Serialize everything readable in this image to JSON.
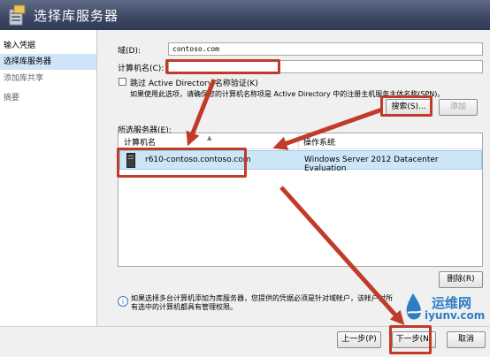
{
  "window": {
    "title": "选择库服务器"
  },
  "nav": {
    "items": [
      {
        "label": "输入凭据",
        "selected": false
      },
      {
        "label": "选择库服务器",
        "selected": true
      },
      {
        "label": "添加库共享",
        "selected": false
      },
      {
        "label": "摘要",
        "selected": false
      }
    ]
  },
  "form": {
    "domain_label": "域(D):",
    "domain_value": "contoso.com",
    "computer_label": "计算机名(C):",
    "computer_value": "",
    "skip_ad_label": "跳过 Active Directory 名称验证(K)",
    "skip_ad_note": "如果使用此选项，请确保您的计算机名称项是 Active Directory 中的注册主机服务主体名称(SPN)。",
    "search_button": "搜索(S)...",
    "add_button": "添加",
    "selected_servers_label": "所选服务器(E):",
    "remove_button": "删除(R)"
  },
  "table": {
    "columns": [
      "计算机名",
      "操作系统"
    ],
    "rows": [
      {
        "name": "r610-contoso.contoso.com",
        "os": "Windows Server 2012 Datacenter Evaluation"
      }
    ]
  },
  "info": {
    "text": "如果选择多台计算机添加为库服务器，您提供的凭据必须是针对域帐户，该帐户对所有选中的计算机都具有管理权限。"
  },
  "footer": {
    "prev_button": "上一步(P)",
    "next_button": "下一步(N)",
    "cancel_button": "取消"
  },
  "watermark": {
    "line1": "运维网",
    "line2": "iyunv.com"
  },
  "colors": {
    "annotation": "#c13b2a",
    "selection": "#cde6f7",
    "titlebar": "#3b4763"
  }
}
